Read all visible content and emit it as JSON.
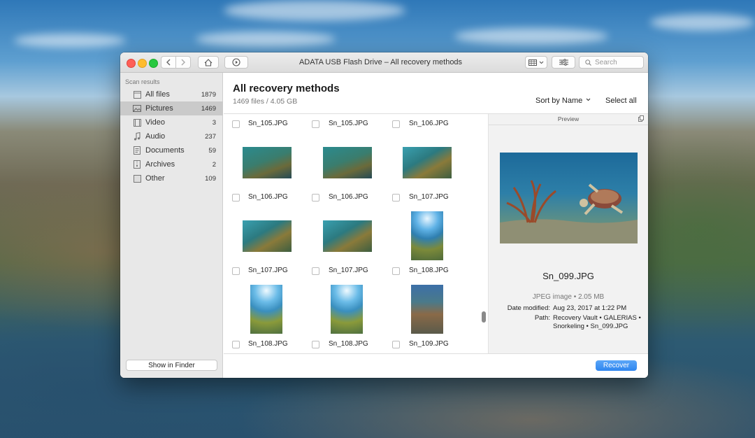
{
  "window": {
    "title": "ADATA USB Flash Drive – All recovery methods"
  },
  "toolbar": {
    "search_placeholder": "Search"
  },
  "sidebar": {
    "header": "Scan results",
    "items": [
      {
        "label": "All files",
        "count": "1879",
        "icon": "files-icon"
      },
      {
        "label": "Pictures",
        "count": "1469",
        "icon": "pictures-icon"
      },
      {
        "label": "Video",
        "count": "3",
        "icon": "video-icon"
      },
      {
        "label": "Audio",
        "count": "237",
        "icon": "audio-icon"
      },
      {
        "label": "Documents",
        "count": "59",
        "icon": "documents-icon"
      },
      {
        "label": "Archives",
        "count": "2",
        "icon": "archives-icon"
      },
      {
        "label": "Other",
        "count": "109",
        "icon": "other-icon"
      }
    ],
    "show_in_finder": "Show in Finder"
  },
  "content": {
    "title": "All recovery methods",
    "subtitle": "1469 files / 4.05 GB",
    "sort_label": "Sort by Name",
    "select_all": "Select all"
  },
  "grid": {
    "top_labels": [
      "Sn_105.JPG",
      "Sn_105.JPG",
      "Sn_106.JPG"
    ],
    "rows": [
      {
        "labels": [
          "Sn_106.JPG",
          "Sn_106.JPG",
          "Sn_107.JPG"
        ]
      },
      {
        "labels": [
          "Sn_107.JPG",
          "Sn_107.JPG",
          "Sn_108.JPG"
        ]
      },
      {
        "labels": [
          "Sn_108.JPG",
          "Sn_108.JPG",
          "Sn_109.JPG"
        ]
      }
    ]
  },
  "preview": {
    "header": "Preview",
    "filename": "Sn_099.JPG",
    "type": "JPEG image • 2.05 MB",
    "date_label": "Date modified:",
    "date_value": "Aug 23, 2017 at 1:22 PM",
    "path_label": "Path:",
    "path_line1": "Recovery Vault • GALERIAS •",
    "path_line2": "Snorkeling • Sn_099.JPG"
  },
  "footer": {
    "recover": "Recover"
  },
  "colors": {
    "accent": "#2f86ef",
    "selected_sidebar": "#cacaca"
  }
}
